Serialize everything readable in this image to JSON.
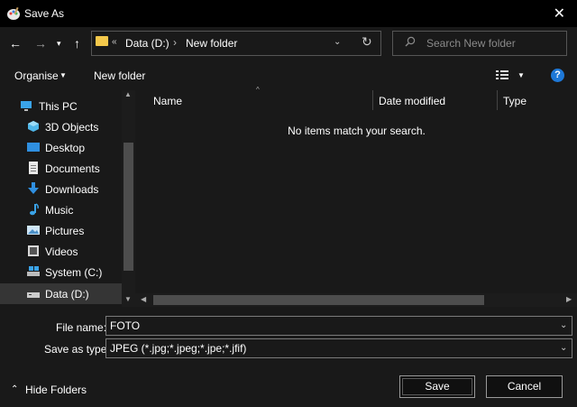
{
  "window": {
    "title": "Save As",
    "close_glyph": "✕",
    "app_icon": "paint-palette-icon"
  },
  "nav": {
    "back_glyph": "←",
    "forward_glyph": "→",
    "recent_glyph": "▾",
    "up_glyph": "↑",
    "breadcrumb": {
      "prefix": "«",
      "items": [
        "Data (D:)",
        "New folder"
      ],
      "separator": "›"
    },
    "dropdown_glyph": "⌄",
    "refresh_glyph": "↻",
    "search_placeholder": "Search New folder"
  },
  "toolbar": {
    "organise": "Organise",
    "caret": "▼",
    "new_folder": "New folder",
    "help": "?"
  },
  "sidebar": {
    "items": [
      {
        "label": "This PC",
        "icon": "this-pc-icon"
      },
      {
        "label": "3D Objects",
        "icon": "3d-objects-icon"
      },
      {
        "label": "Desktop",
        "icon": "desktop-icon"
      },
      {
        "label": "Documents",
        "icon": "documents-icon"
      },
      {
        "label": "Downloads",
        "icon": "downloads-icon"
      },
      {
        "label": "Music",
        "icon": "music-icon"
      },
      {
        "label": "Pictures",
        "icon": "pictures-icon"
      },
      {
        "label": "Videos",
        "icon": "videos-icon"
      },
      {
        "label": "System (C:)",
        "icon": "system-drive-icon"
      },
      {
        "label": "Data (D:)",
        "icon": "data-drive-icon"
      }
    ],
    "selected": "Data (D:)"
  },
  "content": {
    "columns": [
      "Name",
      "Date modified",
      "Type"
    ],
    "sort_glyph": "^",
    "empty_message": "No items match your search."
  },
  "scroll": {
    "up": "▲",
    "down": "▼",
    "left": "◀",
    "right": "▶"
  },
  "form": {
    "file_name_label": "File name:",
    "file_name_value": "FOTO",
    "save_type_label": "Save as type:",
    "save_type_value": "JPEG (*.jpg;*.jpeg;*.jpe;*.jfif)",
    "dropdown_glyph": "⌄"
  },
  "footer": {
    "hide_folders": "Hide Folders",
    "hide_caret": "⌃",
    "save": "Save",
    "cancel": "Cancel"
  },
  "colors": {
    "background": "#191919",
    "titlebar": "#000000",
    "accent_help": "#1e78d7",
    "folder": "#f4c84b"
  }
}
